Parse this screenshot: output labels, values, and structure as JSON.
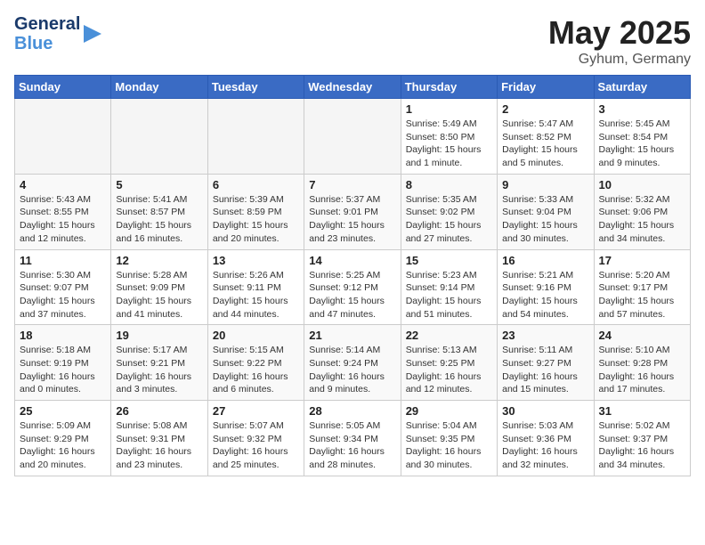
{
  "header": {
    "logo_line1": "General",
    "logo_line2": "Blue",
    "month": "May 2025",
    "location": "Gyhum, Germany"
  },
  "days_of_week": [
    "Sunday",
    "Monday",
    "Tuesday",
    "Wednesday",
    "Thursday",
    "Friday",
    "Saturday"
  ],
  "weeks": [
    [
      {
        "day": "",
        "info": ""
      },
      {
        "day": "",
        "info": ""
      },
      {
        "day": "",
        "info": ""
      },
      {
        "day": "",
        "info": ""
      },
      {
        "day": "1",
        "info": "Sunrise: 5:49 AM\nSunset: 8:50 PM\nDaylight: 15 hours\nand 1 minute."
      },
      {
        "day": "2",
        "info": "Sunrise: 5:47 AM\nSunset: 8:52 PM\nDaylight: 15 hours\nand 5 minutes."
      },
      {
        "day": "3",
        "info": "Sunrise: 5:45 AM\nSunset: 8:54 PM\nDaylight: 15 hours\nand 9 minutes."
      }
    ],
    [
      {
        "day": "4",
        "info": "Sunrise: 5:43 AM\nSunset: 8:55 PM\nDaylight: 15 hours\nand 12 minutes."
      },
      {
        "day": "5",
        "info": "Sunrise: 5:41 AM\nSunset: 8:57 PM\nDaylight: 15 hours\nand 16 minutes."
      },
      {
        "day": "6",
        "info": "Sunrise: 5:39 AM\nSunset: 8:59 PM\nDaylight: 15 hours\nand 20 minutes."
      },
      {
        "day": "7",
        "info": "Sunrise: 5:37 AM\nSunset: 9:01 PM\nDaylight: 15 hours\nand 23 minutes."
      },
      {
        "day": "8",
        "info": "Sunrise: 5:35 AM\nSunset: 9:02 PM\nDaylight: 15 hours\nand 27 minutes."
      },
      {
        "day": "9",
        "info": "Sunrise: 5:33 AM\nSunset: 9:04 PM\nDaylight: 15 hours\nand 30 minutes."
      },
      {
        "day": "10",
        "info": "Sunrise: 5:32 AM\nSunset: 9:06 PM\nDaylight: 15 hours\nand 34 minutes."
      }
    ],
    [
      {
        "day": "11",
        "info": "Sunrise: 5:30 AM\nSunset: 9:07 PM\nDaylight: 15 hours\nand 37 minutes."
      },
      {
        "day": "12",
        "info": "Sunrise: 5:28 AM\nSunset: 9:09 PM\nDaylight: 15 hours\nand 41 minutes."
      },
      {
        "day": "13",
        "info": "Sunrise: 5:26 AM\nSunset: 9:11 PM\nDaylight: 15 hours\nand 44 minutes."
      },
      {
        "day": "14",
        "info": "Sunrise: 5:25 AM\nSunset: 9:12 PM\nDaylight: 15 hours\nand 47 minutes."
      },
      {
        "day": "15",
        "info": "Sunrise: 5:23 AM\nSunset: 9:14 PM\nDaylight: 15 hours\nand 51 minutes."
      },
      {
        "day": "16",
        "info": "Sunrise: 5:21 AM\nSunset: 9:16 PM\nDaylight: 15 hours\nand 54 minutes."
      },
      {
        "day": "17",
        "info": "Sunrise: 5:20 AM\nSunset: 9:17 PM\nDaylight: 15 hours\nand 57 minutes."
      }
    ],
    [
      {
        "day": "18",
        "info": "Sunrise: 5:18 AM\nSunset: 9:19 PM\nDaylight: 16 hours\nand 0 minutes."
      },
      {
        "day": "19",
        "info": "Sunrise: 5:17 AM\nSunset: 9:21 PM\nDaylight: 16 hours\nand 3 minutes."
      },
      {
        "day": "20",
        "info": "Sunrise: 5:15 AM\nSunset: 9:22 PM\nDaylight: 16 hours\nand 6 minutes."
      },
      {
        "day": "21",
        "info": "Sunrise: 5:14 AM\nSunset: 9:24 PM\nDaylight: 16 hours\nand 9 minutes."
      },
      {
        "day": "22",
        "info": "Sunrise: 5:13 AM\nSunset: 9:25 PM\nDaylight: 16 hours\nand 12 minutes."
      },
      {
        "day": "23",
        "info": "Sunrise: 5:11 AM\nSunset: 9:27 PM\nDaylight: 16 hours\nand 15 minutes."
      },
      {
        "day": "24",
        "info": "Sunrise: 5:10 AM\nSunset: 9:28 PM\nDaylight: 16 hours\nand 17 minutes."
      }
    ],
    [
      {
        "day": "25",
        "info": "Sunrise: 5:09 AM\nSunset: 9:29 PM\nDaylight: 16 hours\nand 20 minutes."
      },
      {
        "day": "26",
        "info": "Sunrise: 5:08 AM\nSunset: 9:31 PM\nDaylight: 16 hours\nand 23 minutes."
      },
      {
        "day": "27",
        "info": "Sunrise: 5:07 AM\nSunset: 9:32 PM\nDaylight: 16 hours\nand 25 minutes."
      },
      {
        "day": "28",
        "info": "Sunrise: 5:05 AM\nSunset: 9:34 PM\nDaylight: 16 hours\nand 28 minutes."
      },
      {
        "day": "29",
        "info": "Sunrise: 5:04 AM\nSunset: 9:35 PM\nDaylight: 16 hours\nand 30 minutes."
      },
      {
        "day": "30",
        "info": "Sunrise: 5:03 AM\nSunset: 9:36 PM\nDaylight: 16 hours\nand 32 minutes."
      },
      {
        "day": "31",
        "info": "Sunrise: 5:02 AM\nSunset: 9:37 PM\nDaylight: 16 hours\nand 34 minutes."
      }
    ]
  ]
}
